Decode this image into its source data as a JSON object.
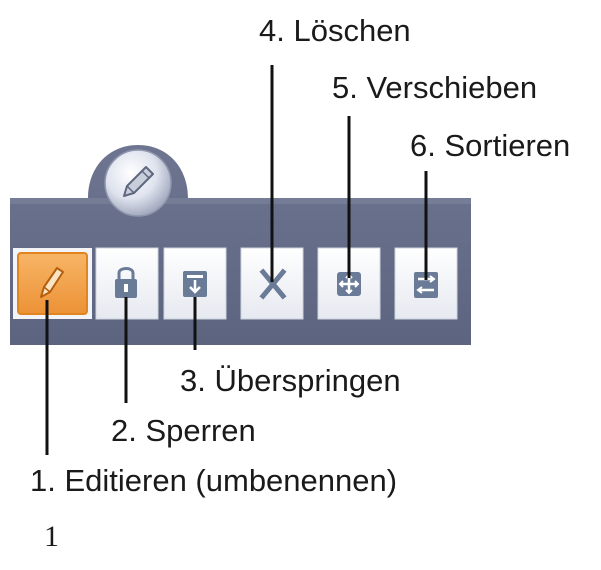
{
  "labels": {
    "edit": "1. Editieren (umbenennen)",
    "lock": "2. Sperren",
    "skip": "3. Überspringen",
    "delete": "4. Löschen",
    "move": "5. Verschieben",
    "sort": "6. Sortieren"
  },
  "footnote": "1",
  "toolbar": {
    "buttons": [
      {
        "id": "edit",
        "icon": "pencil-icon",
        "active": true
      },
      {
        "id": "lock",
        "icon": "lock-icon",
        "active": false
      },
      {
        "id": "skip",
        "icon": "skip-icon",
        "active": false
      },
      {
        "id": "delete",
        "icon": "x-icon",
        "active": false
      },
      {
        "id": "move",
        "icon": "move-arrows-icon",
        "active": false
      },
      {
        "id": "sort",
        "icon": "sort-icon",
        "active": false
      }
    ],
    "colors": {
      "bar": "#636b86",
      "bar_top_highlight": "#838aa3",
      "button_face": "#f2f4f8",
      "icon_blue": "#6a7b98",
      "active_button": "#f0a24c",
      "active_button_border": "#ec8c2a"
    }
  }
}
